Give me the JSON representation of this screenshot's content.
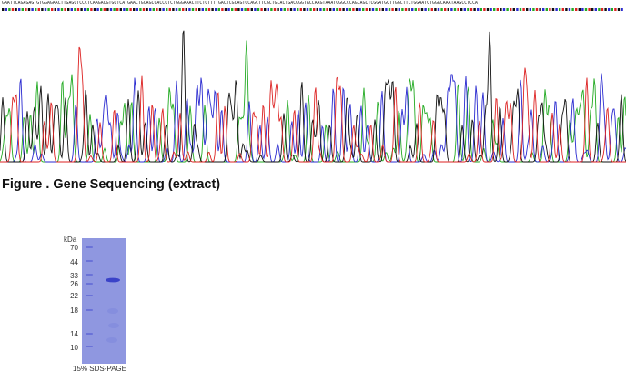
{
  "sequencing": {
    "bases": "GAATTCAGAGAGTGTGGAGAACTTGAGCTCCCTCAAGACGTGCTCATGAACTGCAGCCACCCTCTGGGAAACTTCTCTTTTGACTCGCAGTGCAGCTTCGCTGCACTGACGGGTACCAAGTAAATGGGCCCAGCAGCTCGGATGCTTGGCTTCTGGAATCTGGACAAATAAGCCTCCA",
    "trace_colors": {
      "A": "#22aa22",
      "C": "#2a2ad0",
      "G": "#111111",
      "T": "#dd2222"
    },
    "mark_colors": [
      "#111111",
      "#2a2ad0",
      "#22aa22",
      "#dd2222"
    ]
  },
  "figure_caption": "Figure . Gene Sequencing (extract)",
  "gel": {
    "unit_label": "kDa",
    "markers": [
      "70",
      "44",
      "33",
      "26",
      "22",
      "18",
      "14",
      "10"
    ],
    "caption": "15% SDS-PAGE",
    "background_color": "#8f97e0",
    "band_color": "#3a42c8"
  }
}
